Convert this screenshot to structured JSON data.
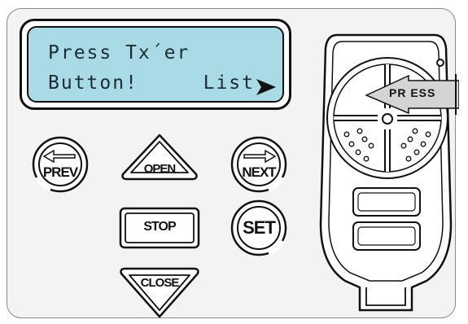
{
  "lcd": {
    "line1": "Press Tx´er",
    "line2": "Button!",
    "list_label": "List"
  },
  "buttons": {
    "prev": "PREV",
    "open": "OPEN",
    "next": "NEXT",
    "stop": "STOP",
    "set": "SET",
    "close": "CLOSE"
  },
  "remote": {
    "press_label": "PR ESS"
  },
  "colors": {
    "lcd_background": "#a9dbe6",
    "panel_background": "#f3f3f3",
    "ink": "#111111"
  }
}
